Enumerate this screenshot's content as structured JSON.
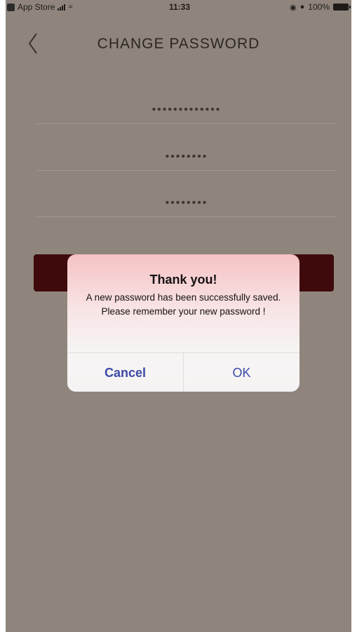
{
  "status_bar": {
    "app_back_label": "App Store",
    "time": "11:33",
    "battery": "100%"
  },
  "nav": {
    "title": "CHANGE PASSWORD"
  },
  "form": {
    "current_password_value": "•••••••••••••",
    "new_password_value": "••••••••",
    "confirm_password_value": "••••••••"
  },
  "dialog": {
    "title": "Thank you!",
    "message": "A new password has been successfully saved. Please remember your new password !",
    "cancel_label": "Cancel",
    "ok_label": "OK"
  },
  "colors": {
    "background": "#8f857c",
    "submit_button": "#3e0a0c",
    "dialog_button_text": "#3d4aa5"
  }
}
